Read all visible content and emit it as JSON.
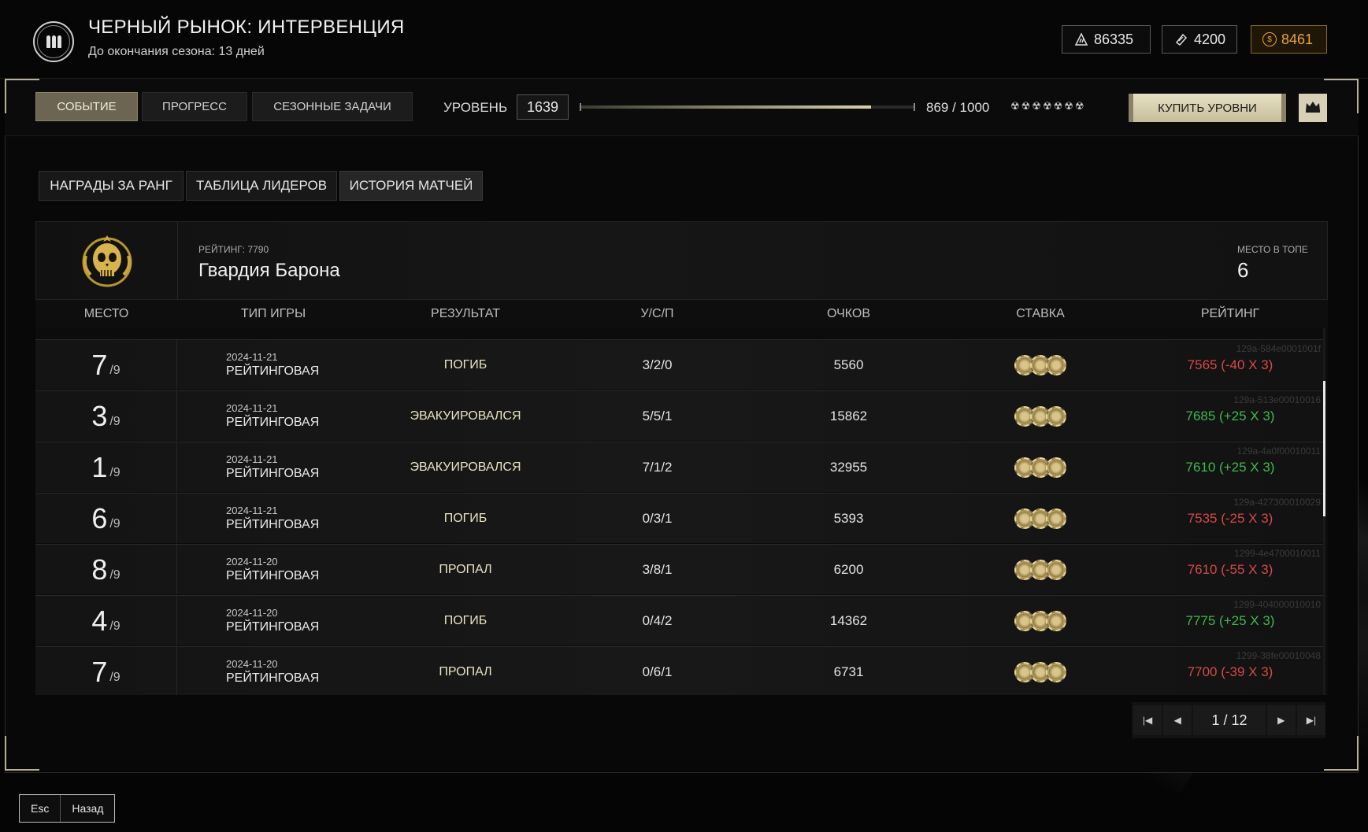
{
  "header": {
    "title": "ЧЕРНЫЙ РЫНОК: ИНТЕРВЕНЦИЯ",
    "subtitle": "До окончания сезона: 13 дней",
    "currencies": [
      {
        "icon": "ammo-currency-icon",
        "value": "86335"
      },
      {
        "icon": "ticket-currency-icon",
        "value": "4200"
      },
      {
        "icon": "gold-coin-icon",
        "value": "8461",
        "color": "#e8a43a"
      }
    ]
  },
  "nav": {
    "tabs": [
      {
        "label": "СОБЫТИЕ",
        "active": true
      },
      {
        "label": "ПРОГРЕСС",
        "active": false
      },
      {
        "label": "СЕЗОННЫЕ ЗАДАЧИ",
        "active": false
      }
    ],
    "level_label": "УРОВЕНЬ",
    "level_value": "1639",
    "xp_text": "869 / 1000",
    "xp_progress": 0.869,
    "stars": "☢☢☢☢☢☢☢",
    "buy_label": "КУПИТЬ УРОВНИ"
  },
  "subtabs": [
    {
      "label": "НАГРАДЫ ЗА РАНГ",
      "active": false
    },
    {
      "label": "ТАБЛИЦА ЛИДЕРОВ",
      "active": false
    },
    {
      "label": "ИСТОРИЯ МАТЧЕЙ",
      "active": true
    }
  ],
  "team": {
    "rating_label": "РЕЙТИНГ: 7790",
    "name": "Гвардия Барона",
    "place_label": "МЕСТО В ТОПЕ",
    "place_value": "6"
  },
  "table": {
    "headers": [
      "МЕСТО",
      "ТИП ИГРЫ",
      "РЕЗУЛЬТАТ",
      "У/С/П",
      "ОЧКОВ",
      "СТАВКА",
      "РЕЙТИНГ"
    ],
    "rows": [
      {
        "place": "7",
        "of": "/9",
        "date": "2024-11-21",
        "type": "РЕЙТИНГОВАЯ",
        "result": "ПОГИБ",
        "kda": "3/2/0",
        "score": "5560",
        "rating": "7565 (-40 X 3)",
        "sign": "neg",
        "id": "129a-584e0001001f"
      },
      {
        "place": "3",
        "of": "/9",
        "date": "2024-11-21",
        "type": "РЕЙТИНГОВАЯ",
        "result": "ЭВАКУИРОВАЛСЯ",
        "kda": "5/5/1",
        "score": "15862",
        "rating": "7685 (+25 X 3)",
        "sign": "pos",
        "id": "129a-513e00010016"
      },
      {
        "place": "1",
        "of": "/9",
        "date": "2024-11-21",
        "type": "РЕЙТИНГОВАЯ",
        "result": "ЭВАКУИРОВАЛСЯ",
        "kda": "7/1/2",
        "score": "32955",
        "rating": "7610 (+25 X 3)",
        "sign": "pos",
        "id": "129a-4a0f00010011"
      },
      {
        "place": "6",
        "of": "/9",
        "date": "2024-11-21",
        "type": "РЕЙТИНГОВАЯ",
        "result": "ПОГИБ",
        "kda": "0/3/1",
        "score": "5393",
        "rating": "7535 (-25 X 3)",
        "sign": "neg",
        "id": "129a-427300010029"
      },
      {
        "place": "8",
        "of": "/9",
        "date": "2024-11-20",
        "type": "РЕЙТИНГОВАЯ",
        "result": "ПРОПАЛ",
        "kda": "3/8/1",
        "score": "6200",
        "rating": "7610 (-55 X 3)",
        "sign": "neg",
        "id": "1299-4e4700010011"
      },
      {
        "place": "4",
        "of": "/9",
        "date": "2024-11-20",
        "type": "РЕЙТИНГОВАЯ",
        "result": "ПОГИБ",
        "kda": "0/4/2",
        "score": "14362",
        "rating": "7775 (+25 X 3)",
        "sign": "pos",
        "id": "1299-404000010010"
      },
      {
        "place": "7",
        "of": "/9",
        "date": "2024-11-20",
        "type": "РЕЙТИНГОВАЯ",
        "result": "ПРОПАЛ",
        "kda": "0/6/1",
        "score": "6731",
        "rating": "7700 (-39 X 3)",
        "sign": "neg",
        "id": "1299-38fe00010048"
      }
    ]
  },
  "pager": {
    "text": "1 / 12"
  },
  "footer": {
    "esc_key": "Esc",
    "back_label": "Назад"
  },
  "colors": {
    "positive": "#3fb94a",
    "negative": "#d44a48",
    "accent": "#e8a43a"
  }
}
